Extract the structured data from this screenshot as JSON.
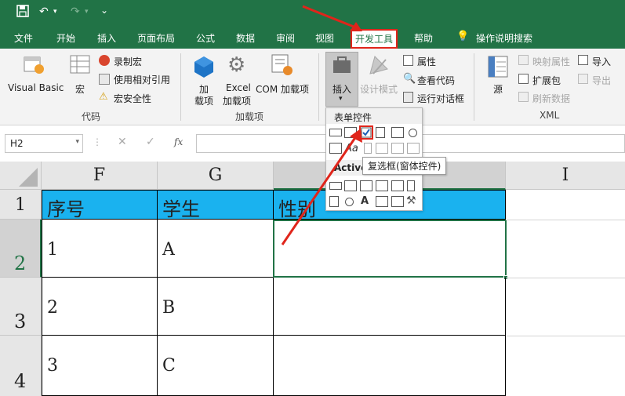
{
  "titlebar": {
    "undo": "↶",
    "redo": "↷",
    "more": "⌄"
  },
  "tabs": [
    "文件",
    "开始",
    "插入",
    "页面布局",
    "公式",
    "数据",
    "审阅",
    "视图",
    "开发工具",
    "帮助",
    "操作说明搜索"
  ],
  "ribbon": {
    "code": {
      "vb": "Visual Basic",
      "macro": "宏",
      "record": "录制宏",
      "relative": "使用相对引用",
      "security": "宏安全性",
      "label": "代码"
    },
    "addins": {
      "addin": "加",
      "addin2": "载项",
      "excel": "Excel",
      "excel2": "加载项",
      "com": "COM 加载项",
      "label": "加载项"
    },
    "controls": {
      "insert": "插入",
      "design": "设计模式",
      "properties": "属性",
      "viewcode": "查看代码",
      "dialog": "运行对话框"
    },
    "xml": {
      "source": "源",
      "map": "映射属性",
      "ext": "扩展包",
      "refresh": "刷新数据",
      "import": "导入",
      "export": "导出",
      "label": "XML"
    }
  },
  "formula_bar": {
    "name_box": "H2",
    "fx": "fx"
  },
  "dropdown": {
    "form_header": "表单控件",
    "activex_header": "Active",
    "tooltip": "复选框(窗体控件)"
  },
  "columns": [
    "F",
    "G",
    "I"
  ],
  "rows": [
    "1",
    "2",
    "3",
    "4"
  ],
  "cells": {
    "F1": "序号",
    "G1": "学生",
    "H1": "性别",
    "F2": "1",
    "G2": "A",
    "F3": "2",
    "G3": "B",
    "F4": "3",
    "G4": "C"
  },
  "colors": {
    "brand": "#217346",
    "header_fill": "#1ab2ef",
    "highlight": "#e0251b"
  }
}
